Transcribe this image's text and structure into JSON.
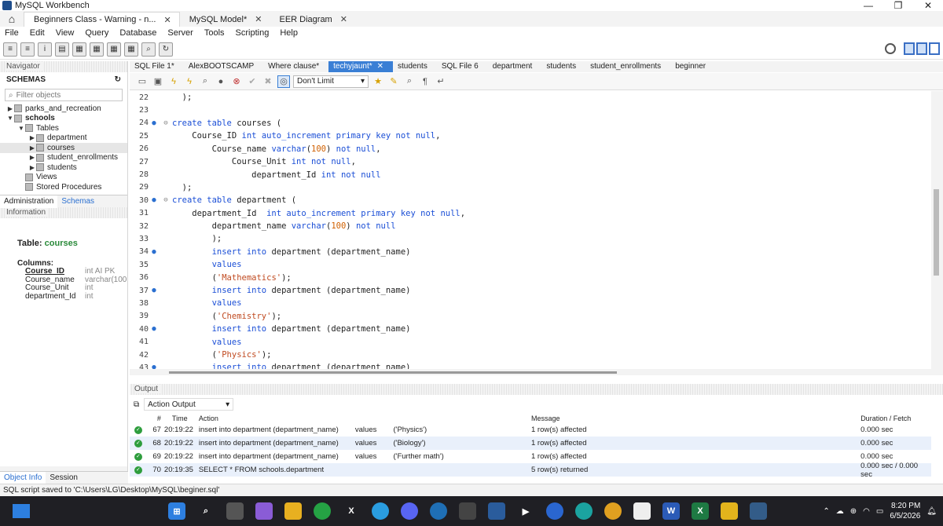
{
  "window": {
    "title": "MySQL Workbench",
    "controls": [
      "—",
      "❐",
      "✕"
    ]
  },
  "doc_tabs": [
    {
      "label": "Beginners Class - Warning - n...",
      "active": true
    },
    {
      "label": "MySQL Model*",
      "active": false
    },
    {
      "label": "EER Diagram",
      "active": false
    }
  ],
  "menu": [
    "File",
    "Edit",
    "View",
    "Query",
    "Database",
    "Server",
    "Tools",
    "Scripting",
    "Help"
  ],
  "navigator": {
    "header": "Navigator",
    "schemas_label": "SCHEMAS",
    "filter_placeholder": "Filter objects",
    "tree": [
      {
        "label": "parks_and_recreation",
        "indent": 0,
        "arrow": "▶",
        "bold": false
      },
      {
        "label": "schools",
        "indent": 0,
        "arrow": "▼",
        "bold": true
      },
      {
        "label": "Tables",
        "indent": 1,
        "arrow": "▼",
        "bold": false
      },
      {
        "label": "department",
        "indent": 2,
        "arrow": "▶",
        "bold": false
      },
      {
        "label": "courses",
        "indent": 2,
        "arrow": "▶",
        "bold": false,
        "selected": true
      },
      {
        "label": "student_enrollments",
        "indent": 2,
        "arrow": "▶",
        "bold": false
      },
      {
        "label": "students",
        "indent": 2,
        "arrow": "▶",
        "bold": false
      },
      {
        "label": "Views",
        "indent": 1,
        "arrow": "",
        "bold": false
      },
      {
        "label": "Stored Procedures",
        "indent": 1,
        "arrow": "",
        "bold": false
      }
    ],
    "tabs": [
      "Administration",
      "Schemas"
    ],
    "info_header": "Information",
    "info": {
      "table_label": "Table:",
      "table_name": "courses",
      "columns_label": "Columns:",
      "columns": [
        {
          "name": "Course_ID",
          "type": "int AI PK"
        },
        {
          "name": "Course_name",
          "type": "varchar(100"
        },
        {
          "name": "Course_Unit",
          "type": "int"
        },
        {
          "name": "department_Id",
          "type": "int"
        }
      ]
    },
    "bottom_tabs": [
      "Object Info",
      "Session"
    ]
  },
  "sql_tabs": [
    {
      "label": "SQL File 1*",
      "active": false
    },
    {
      "label": "AlexBOOTSCAMP",
      "active": false
    },
    {
      "label": "Where clause*",
      "active": false
    },
    {
      "label": "techyjaunt*",
      "active": true,
      "close": "✕"
    },
    {
      "label": "students",
      "active": false
    },
    {
      "label": "SQL File 6",
      "active": false
    },
    {
      "label": "department",
      "active": false
    },
    {
      "label": "students",
      "active": false
    },
    {
      "label": "student_enrollments",
      "active": false
    },
    {
      "label": "beginner",
      "active": false
    }
  ],
  "limit_select": "Don't Limit",
  "code_lines": [
    {
      "n": "22",
      "dot": false,
      "fold": "",
      "text": "  );"
    },
    {
      "n": "23",
      "dot": false,
      "fold": "",
      "text": ""
    },
    {
      "n": "24",
      "dot": true,
      "fold": "⊖",
      "text": "create table courses ("
    },
    {
      "n": "25",
      "dot": false,
      "fold": "",
      "text": "    Course_ID int auto_increment primary key not null,"
    },
    {
      "n": "26",
      "dot": false,
      "fold": "",
      "text": "        Course_name varchar(100) not null,"
    },
    {
      "n": "27",
      "dot": false,
      "fold": "",
      "text": "            Course_Unit int not null,"
    },
    {
      "n": "28",
      "dot": false,
      "fold": "",
      "text": "                department_Id int not null"
    },
    {
      "n": "29",
      "dot": false,
      "fold": "",
      "text": "  );"
    },
    {
      "n": "30",
      "dot": true,
      "fold": "⊖",
      "text": "create table department ("
    },
    {
      "n": "31",
      "dot": false,
      "fold": "",
      "text": "    department_Id  int auto_increment primary key not null,"
    },
    {
      "n": "32",
      "dot": false,
      "fold": "",
      "text": "        department_name varchar(100) not null"
    },
    {
      "n": "33",
      "dot": false,
      "fold": "",
      "text": "        );"
    },
    {
      "n": "34",
      "dot": true,
      "fold": "",
      "text": "        insert into department (department_name)"
    },
    {
      "n": "35",
      "dot": false,
      "fold": "",
      "text": "        values"
    },
    {
      "n": "36",
      "dot": false,
      "fold": "",
      "text": "        ('Mathematics');"
    },
    {
      "n": "37",
      "dot": true,
      "fold": "",
      "text": "        insert into department (department_name)"
    },
    {
      "n": "38",
      "dot": false,
      "fold": "",
      "text": "        values"
    },
    {
      "n": "39",
      "dot": false,
      "fold": "",
      "text": "        ('Chemistry');"
    },
    {
      "n": "40",
      "dot": true,
      "fold": "",
      "text": "        insert into department (department_name)"
    },
    {
      "n": "41",
      "dot": false,
      "fold": "",
      "text": "        values"
    },
    {
      "n": "42",
      "dot": false,
      "fold": "",
      "text": "        ('Physics');"
    },
    {
      "n": "43",
      "dot": true,
      "fold": "",
      "text": "        insert into department (department_name)"
    }
  ],
  "output": {
    "header": "Output",
    "selector": "Action Output",
    "columns": {
      "num": "#",
      "time": "Time",
      "action": "Action",
      "message": "Message",
      "duration": "Duration / Fetch"
    },
    "rows": [
      {
        "num": "67",
        "time": "20:19:22",
        "action": "insert into department (department_name)        values        ('Physics')",
        "message": "1 row(s) affected",
        "duration": "0.000 sec"
      },
      {
        "num": "68",
        "time": "20:19:22",
        "action": "insert into department (department_name)        values        ('Biology')",
        "message": "1 row(s) affected",
        "duration": "0.000 sec"
      },
      {
        "num": "69",
        "time": "20:19:22",
        "action": "insert into department (department_name)        values        ('Further math')",
        "message": "1 row(s) affected",
        "duration": "0.000 sec"
      },
      {
        "num": "70",
        "time": "20:19:35",
        "action": "SELECT * FROM schools.department",
        "message": "5 row(s) returned",
        "duration": "0.000 sec / 0.000 sec"
      }
    ]
  },
  "statusbar": "SQL script saved to 'C:\\Users\\LG\\Desktop\\MySQL\\beginer.sql'",
  "taskbar": {
    "time": "8:20 PM",
    "date": "6/5/2026"
  },
  "colors": {
    "accent": "#3a7fd5",
    "keyword": "#1a4ed6",
    "string": "#c04a20",
    "ok": "#2e9d3d"
  }
}
